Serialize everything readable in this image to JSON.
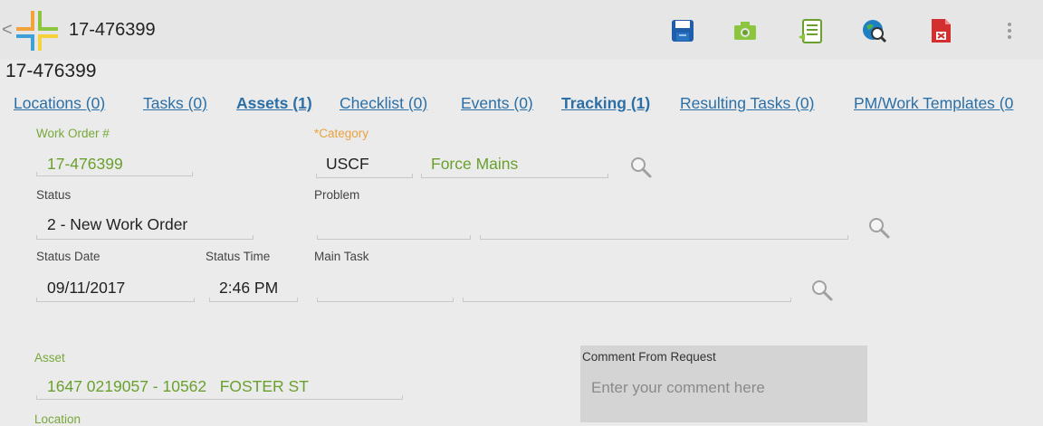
{
  "appbar": {
    "title": "17-476399",
    "icons": [
      "save-icon",
      "camera-icon",
      "document-icon",
      "globe-search-icon",
      "pdf-close-icon",
      "overflow-menu-icon"
    ],
    "back_glyph": "<"
  },
  "page_title": "17-476399",
  "tabs": [
    {
      "label": "Locations (0)",
      "bold": false
    },
    {
      "label": "Tasks (0)",
      "bold": false
    },
    {
      "label": "Assets (1)",
      "bold": true
    },
    {
      "label": "Checklist (0)",
      "bold": false
    },
    {
      "label": "Events (0)",
      "bold": false
    },
    {
      "label": "Tracking (1)",
      "bold": true
    },
    {
      "label": "Resulting Tasks (0)",
      "bold": false
    },
    {
      "label": "PM/Work Templates (0",
      "bold": false
    }
  ],
  "form": {
    "work_order_label": "Work Order #",
    "work_order_value": "17-476399",
    "category_label": "*Category",
    "category_code": "USCF",
    "category_desc": "Force Mains",
    "status_label": "Status",
    "status_value": "2 - New Work Order",
    "problem_label": "Problem",
    "problem_code": "",
    "problem_desc": "",
    "status_date_label": "Status Date",
    "status_date_value": "09/11/2017",
    "status_time_label": "Status Time",
    "status_time_value": "2:46 PM",
    "main_task_label": "Main Task",
    "main_task_code": "",
    "main_task_desc": "",
    "asset_label": "Asset",
    "asset_value": "1647 0219057 - 10562   FOSTER ST",
    "location_label": "Location",
    "comment_label": "Comment From Request",
    "comment_placeholder": "Enter your comment here"
  },
  "colors": {
    "tab_link": "#2b6fa6",
    "field_green": "#6aa02e",
    "label_orange": "#e8a340",
    "comment_bg": "#d4d4d4"
  }
}
